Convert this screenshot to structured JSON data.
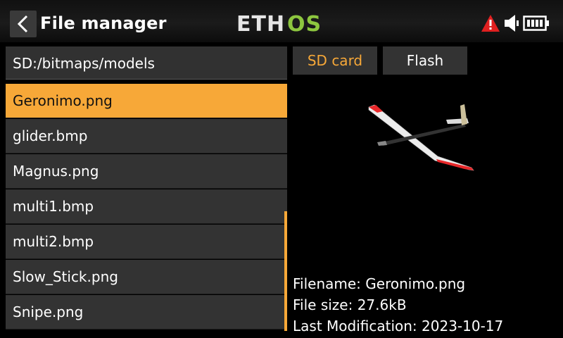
{
  "header": {
    "title": "File manager",
    "logo_text": "ETHOS",
    "icons": [
      "back-arrow-icon",
      "warning-icon",
      "speaker-icon",
      "battery-icon"
    ]
  },
  "path": "SD:/bitmaps/models",
  "files": [
    {
      "name": "Geronimo.png",
      "selected": true
    },
    {
      "name": "glider.bmp"
    },
    {
      "name": "Magnus.png"
    },
    {
      "name": "multi1.bmp"
    },
    {
      "name": "multi2.bmp"
    },
    {
      "name": "Slow_Stick.png"
    },
    {
      "name": "Snipe.png"
    }
  ],
  "tabs": [
    {
      "label": "SD card",
      "active": true
    },
    {
      "label": "Flash"
    }
  ],
  "details": {
    "filename": "Filename: Geronimo.png",
    "size": "File size: 27.6kB",
    "modified": "Last Modification: 2023-10-17"
  },
  "colors": {
    "accent": "#f7a838",
    "logo_green": "#8dc63f",
    "warning": "#e02020"
  }
}
